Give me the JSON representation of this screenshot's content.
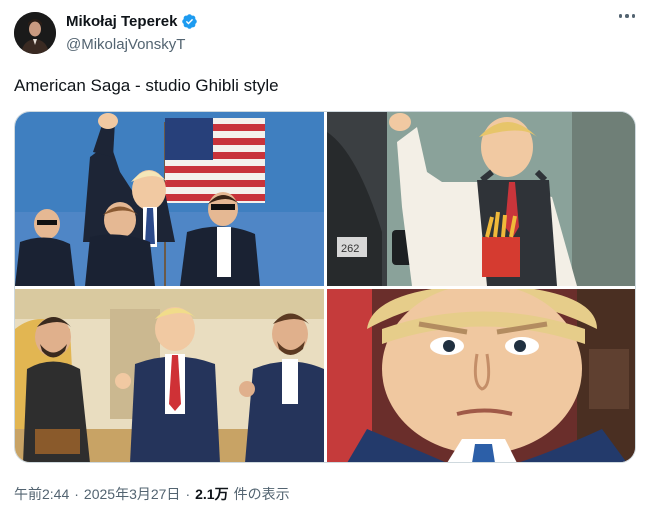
{
  "author": {
    "display_name": "Mikołaj Teperek",
    "handle": "@MikolajVonskyT",
    "avatar_icon": "profile-photo-icon",
    "verified_icon": "verified-badge-icon",
    "verified_color": "#1d9bf0"
  },
  "tweet": {
    "text": "American Saga - studio Ghibli style",
    "media": [
      {
        "label": "Ghibli-style illustration: man with raised fist and US flag, surrounded by agents"
      },
      {
        "label": "Ghibli-style illustration: man in apron holding fries at drive-through window"
      },
      {
        "label": "Ghibli-style illustration: three men talking in an ornate office"
      },
      {
        "label": "Ghibli-style illustration: close-up of a frowning man in a suit"
      }
    ],
    "drive_thru_plate": "262"
  },
  "meta": {
    "time": "午前2:44",
    "separator": "·",
    "date": "2025年3月27日",
    "views_count": "2.1万",
    "views_label": "件の表示"
  },
  "menu_icon": "more-options-icon"
}
